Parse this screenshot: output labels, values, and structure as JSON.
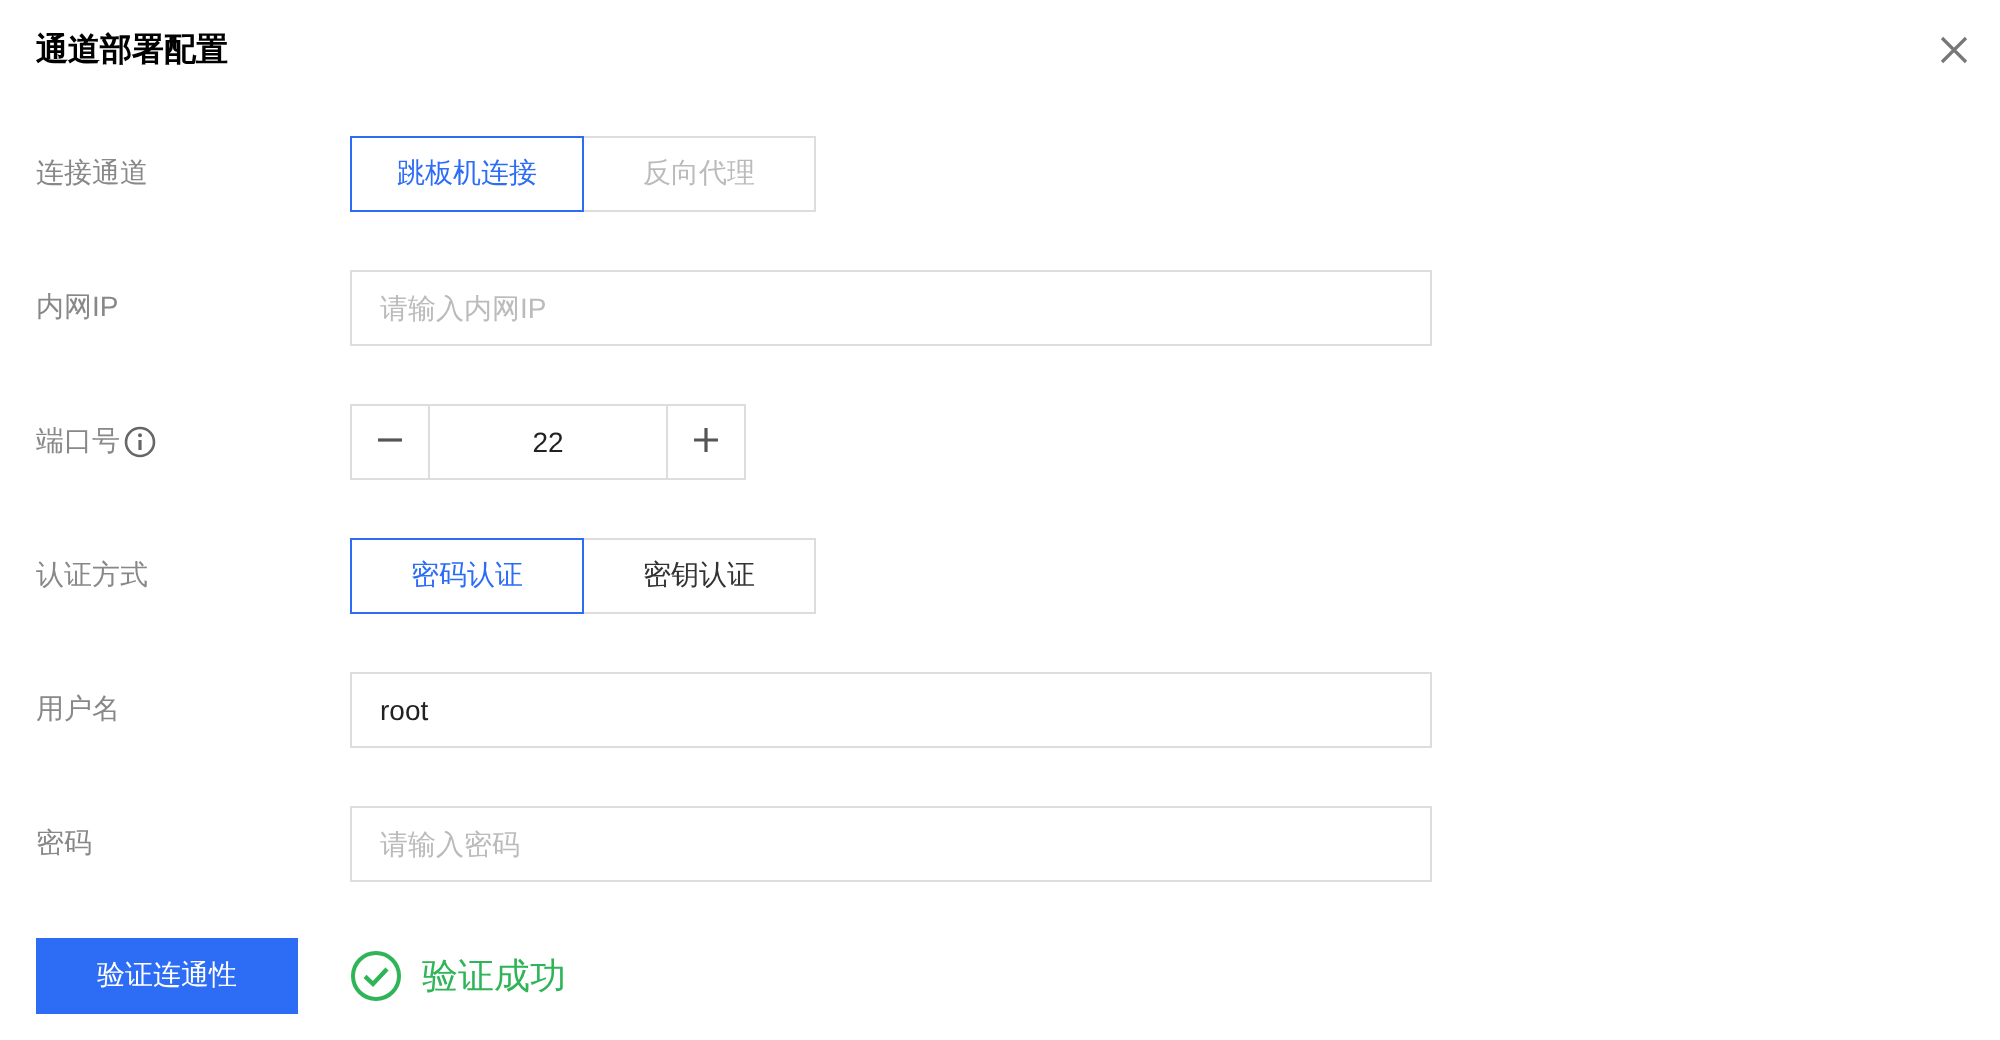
{
  "dialog": {
    "title": "通道部署配置"
  },
  "fields": [
    {
      "kind": "segmented",
      "label": "连接通道",
      "options": [
        {
          "label": "跳板机连接",
          "selected": true,
          "disabled": false
        },
        {
          "label": "反向代理",
          "selected": false,
          "disabled": true
        }
      ]
    },
    {
      "kind": "input",
      "label": "内网IP",
      "placeholder": "请输入内网IP"
    },
    {
      "kind": "stepper",
      "label": "端口号",
      "help_icon": true,
      "value": "22"
    },
    {
      "kind": "segmented",
      "label": "认证方式",
      "options": [
        {
          "label": "密码认证",
          "selected": true,
          "disabled": false
        },
        {
          "label": "密钥认证",
          "selected": false,
          "disabled": false
        }
      ]
    },
    {
      "kind": "input",
      "label": "用户名",
      "value": "root"
    },
    {
      "kind": "input",
      "label": "密码",
      "placeholder": "请输入密码"
    }
  ],
  "verify": {
    "button": "验证连通性",
    "success": true,
    "message": "验证成功"
  }
}
